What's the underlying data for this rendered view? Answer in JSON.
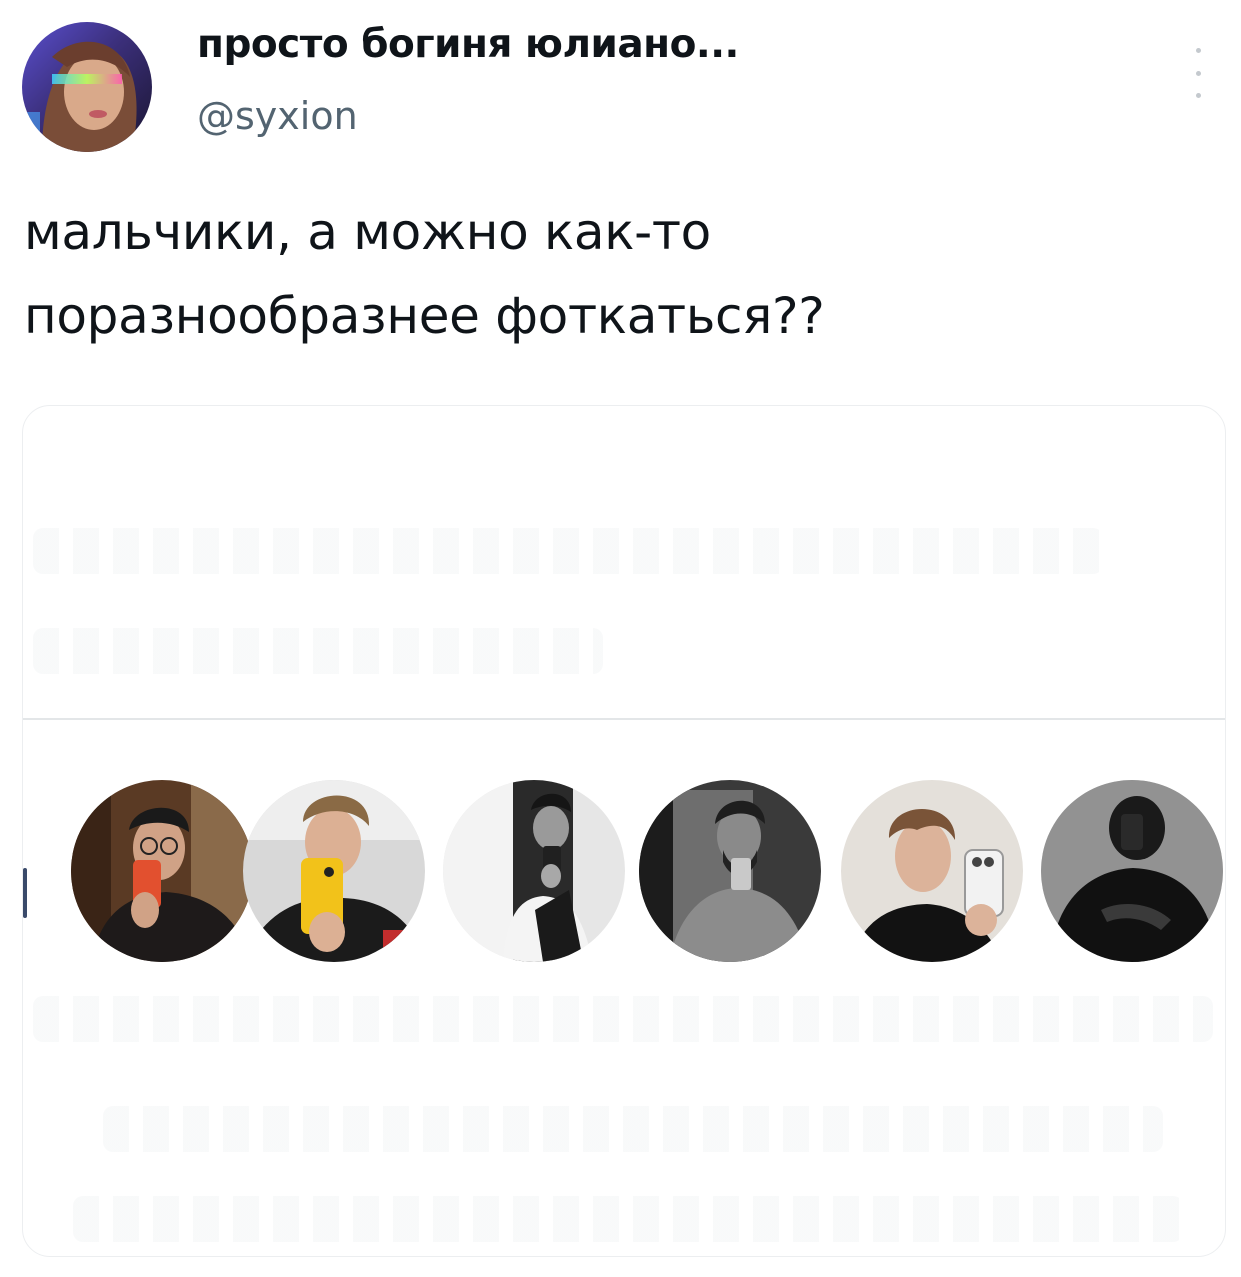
{
  "tweet": {
    "display_name": "просто богиня юлиано...",
    "handle": "@syxion",
    "text": "мальчики, а можно как-то\nпоразнообразнее фоткаться??",
    "avatar_icon": "user-avatar-photo",
    "more_icon": "more-options-icon"
  },
  "media": {
    "face_photos": [
      "profile-photo-mirror-selfie-red-phone",
      "profile-photo-mirror-selfie-yellow-phone",
      "profile-photo-mirror-selfie-bw",
      "profile-photo-mirror-selfie-shirtless",
      "profile-photo-selfie-white-phone",
      "profile-photo-mirror-selfie-dark-hood"
    ]
  },
  "colors": {
    "text": "#0f1419",
    "secondary": "#536471",
    "border": "#eceef0"
  }
}
